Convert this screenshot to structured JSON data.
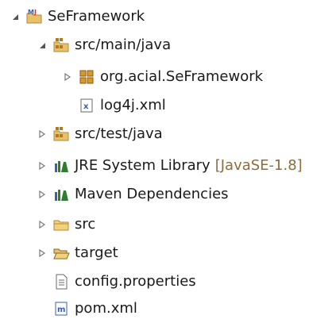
{
  "tree": {
    "nodes": [
      {
        "label": "SeFramework",
        "icon": "maven-project-icon",
        "state": "expanded"
      },
      {
        "label": "src/main/java",
        "icon": "source-folder-icon",
        "state": "expanded"
      },
      {
        "label": "org.acial.SeFramework",
        "icon": "package-icon",
        "state": "collapsed"
      },
      {
        "label": "log4j.xml",
        "icon": "xml-file-icon",
        "state": "leaf"
      },
      {
        "label": "src/test/java",
        "icon": "source-folder-icon",
        "state": "collapsed"
      },
      {
        "label": "JRE System Library",
        "decoration": "[JavaSE-1.8]",
        "icon": "library-icon",
        "state": "collapsed"
      },
      {
        "label": "Maven Dependencies",
        "icon": "library-icon",
        "state": "collapsed"
      },
      {
        "label": "src",
        "icon": "folder-icon",
        "state": "collapsed"
      },
      {
        "label": "target",
        "icon": "open-folder-icon",
        "state": "collapsed"
      },
      {
        "label": "config.properties",
        "icon": "properties-file-icon",
        "state": "leaf"
      },
      {
        "label": "pom.xml",
        "icon": "maven-pom-icon",
        "state": "leaf"
      }
    ]
  },
  "colors": {
    "text": "#1a1a1a",
    "decoration": "#8a6d3b",
    "twisty": "#7a7a7a",
    "folder": "#e8c06a",
    "library_green": "#2e7d32",
    "library_blue": "#3a5fb0",
    "package": "#b07a1a"
  }
}
